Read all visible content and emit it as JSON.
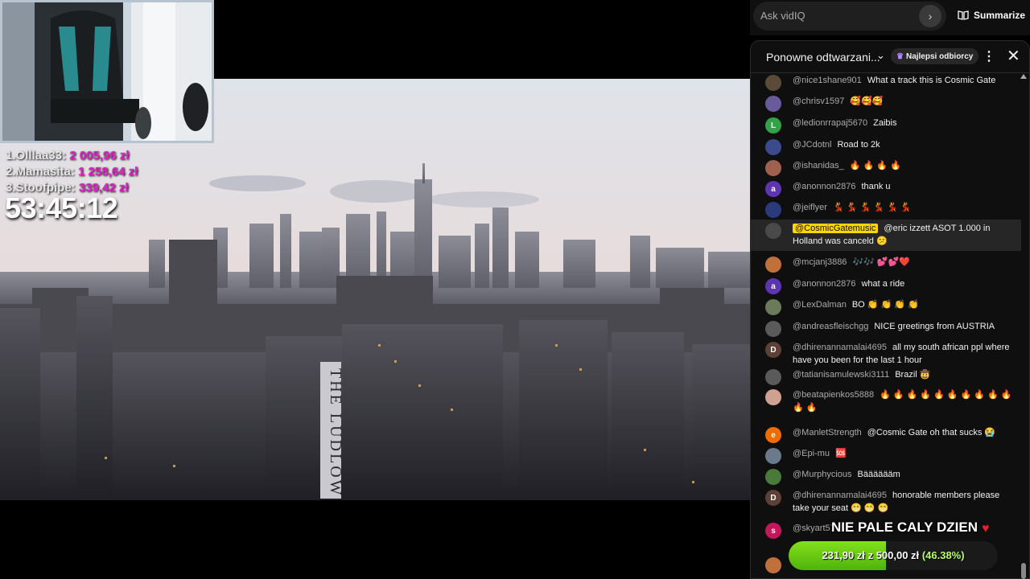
{
  "overlay": {
    "donors": [
      {
        "name": "1.Olllaa33:",
        "amount": "2 005,96 zł"
      },
      {
        "name": "2.Mamasita:",
        "amount": "1 258,64 zł"
      },
      {
        "name": "3.Stoofpipe:",
        "amount": "339,42 zł"
      }
    ],
    "timer": "53:45:12",
    "building_sign": "THE LUDLOW"
  },
  "vidiq": {
    "ask_placeholder": "Ask vidIQ",
    "summarize_label": "Summarize"
  },
  "chat": {
    "title": "Ponowne odtwarzani...",
    "badge": "Najlepsi odbiorcy",
    "messages": [
      {
        "author": "@nice1shane901",
        "text": "What a track this is Cosmic Gate",
        "avatar": "",
        "color": "#5b4a3a"
      },
      {
        "author": "@chrisv1597",
        "text": "🥰🥰🥰",
        "avatar": "",
        "color": "#6a5a9a"
      },
      {
        "author": "@ledionrrapaj5670",
        "text": "Zaibis",
        "avatar": "L",
        "color": "#33a04a"
      },
      {
        "author": "@JCdotnl",
        "text": "Road to 2k",
        "avatar": "",
        "color": "#3a4a8a"
      },
      {
        "author": "@ishanidas_",
        "text": "🔥 🔥 🔥 🔥",
        "avatar": "",
        "color": "#a06050"
      },
      {
        "author": "@anonnon2876",
        "text": "thank u",
        "avatar": "a",
        "color": "#5e35b1"
      },
      {
        "author": "@jeiflyer",
        "text": "💃 💃 💃 💃 💃 💃",
        "avatar": "",
        "color": "#2a3a7a"
      },
      {
        "author": "@CosmicGatemusic",
        "text": "@eric izzett ASOT 1.000 in Holland was canceld 😕",
        "avatar": "",
        "color": "#4a4a4a",
        "owner": true
      },
      {
        "author": "@mcjanj3886",
        "text": "🎶🎶 💕💕❤️",
        "avatar": "",
        "color": "#c0703a"
      },
      {
        "author": "@anonnon2876",
        "text": "what a ride",
        "avatar": "a",
        "color": "#5e35b1"
      },
      {
        "author": "@LexDalman",
        "text": "BO 👏 👏 👏 👏",
        "avatar": "",
        "color": "#6a7a5a"
      },
      {
        "author": "@andreasfleischgg",
        "text": "NICE greetings from AUSTRIA",
        "avatar": "",
        "color": "#5a5a5a"
      },
      {
        "author": "@dhirenannamalai4695",
        "text": "all my south african ppl where have you been for the last 1 hour",
        "avatar": "D",
        "color": "#5d4037"
      },
      {
        "author": "@tatianisamulewski3111",
        "text": "Brazil 🤠",
        "avatar": "",
        "color": "#5a5a5a"
      },
      {
        "author": "@beatapienkos5888",
        "text": "🔥 🔥 🔥 🔥 🔥 🔥 🔥 🔥 🔥 🔥 🔥 🔥",
        "avatar": "",
        "color": "#d0a090"
      },
      {
        "author": "@ManletStrength",
        "text": "@Cosmic Gate oh that sucks 😭",
        "avatar": "e",
        "color": "#ef6c00"
      },
      {
        "author": "@Epi-mu",
        "text": "🆘",
        "avatar": "",
        "color": "#6a7a8a"
      },
      {
        "author": "@Murphycious",
        "text": "Bääääääm",
        "avatar": "",
        "color": "#4a7a3a"
      },
      {
        "author": "@dhirenannamalai4695",
        "text": "honorable members please take your seat 😁 😁 😁",
        "avatar": "D",
        "color": "#5d4037"
      },
      {
        "author": "@skyart57",
        "text": "",
        "avatar": "s",
        "color": "#c2185b"
      },
      {
        "author": "",
        "text": "",
        "avatar": "",
        "color": "#c0703a"
      }
    ]
  },
  "goal": {
    "title": "NIE PALE CALY DZIEN",
    "current": "231,90 zł",
    "separator": "z",
    "target": "500,00 zł",
    "percent_label": "(46.38%)",
    "progress": 0.4638
  },
  "colors": {
    "donor_amount": "#e021c5",
    "goal_fill": "#6fcf1a",
    "owner_badge": "#ffd600"
  }
}
